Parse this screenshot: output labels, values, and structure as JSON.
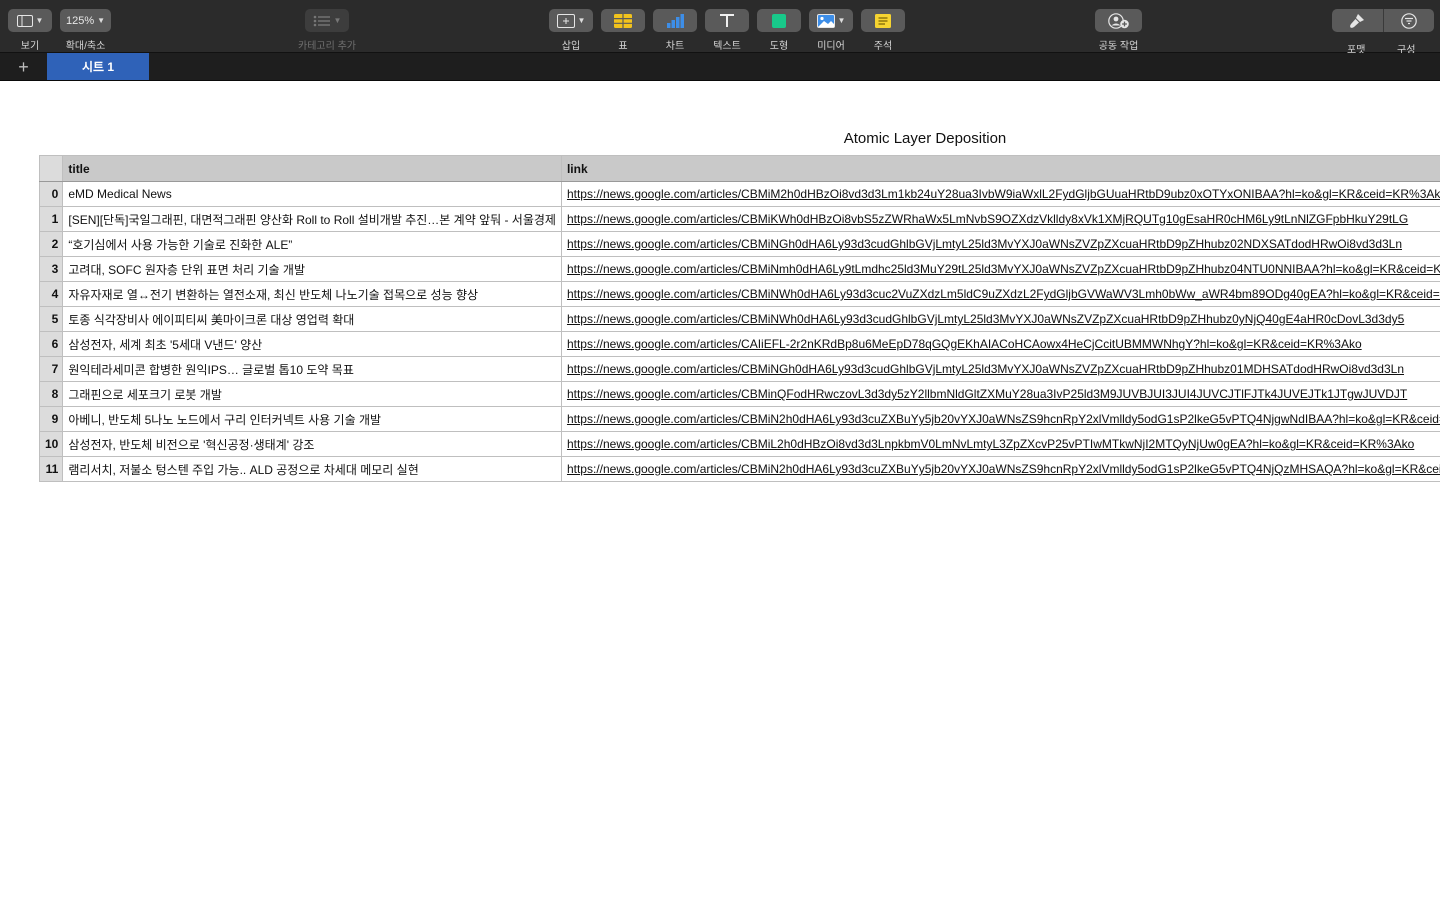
{
  "toolbar": {
    "view_label": "보기",
    "zoom_value": "125%",
    "zoom_label": "확대/축소",
    "category_label": "카테고리 추가",
    "insert_label": "삽입",
    "table_label": "표",
    "chart_label": "차트",
    "text_label": "텍스트",
    "shape_label": "도형",
    "media_label": "미디어",
    "comment_label": "주석",
    "collaborate_label": "공동 작업",
    "format_label": "포맷",
    "organize_label": "구성",
    "colors": {
      "table": "#f2c31d",
      "chart": "#3d8ee8",
      "shape": "#18c98a",
      "comment": "#f6d431"
    }
  },
  "tabs": {
    "add_icon": "plus-icon",
    "sheets": [
      {
        "label": "시트 1",
        "active": true
      }
    ]
  },
  "sheet": {
    "title": "Atomic Layer Deposition",
    "columns": [
      "title",
      "link"
    ],
    "rows": [
      {
        "idx": "0",
        "title": "eMD Medical News",
        "link": "https://news.google.com/articles/CBMiM2h0dHBzOi8vd3d3Lm1kb24uY28ua3IvbW9iaWxlL2FydGljbGUuaHRtbD9ubz0xOTYxONIBAA?hl=ko&gl=KR&ceid=KR%3Ako"
      },
      {
        "idx": "1",
        "title": "[SEN][단독]국일그래핀, 대면적그래핀 양산화 Roll to Roll 설비개발 추진…본 계약 앞둬 - 서울경제",
        "link": "https://news.google.com/articles/CBMiKWh0dHBzOi8vbS5zZWRhaWx5LmNvbS9OZXdzVklldy8xVk1XMjRQUTg10gEsaHR0cHM6Ly9tLnNlZGFpbHkuY29tLG"
      },
      {
        "idx": "2",
        "title": "“호기심에서 사용 가능한 기술로 진화한 ALE”",
        "link": "https://news.google.com/articles/CBMiNGh0dHA6Ly93d3cudGhlbGVjLmtyL25ld3MvYXJ0aWNsZVZpZXcuaHRtbD9pZHhubz02NDXSATdodHRwOi8vd3d3Ln"
      },
      {
        "idx": "3",
        "title": "고려대, SOFC 원자층 단위 표면 처리 기술 개발",
        "link": "https://news.google.com/articles/CBMiNmh0dHA6Ly9tLmdhc25ld3MuY29tL25ld3MvYXJ0aWNsZVZpZXcuaHRtbD9pZHhubz04NTU0NNIBAA?hl=ko&gl=KR&ceid=KR%3Ako"
      },
      {
        "idx": "4",
        "title": "자유자재로 열↔전기 변환하는 열전소재, 최신 반도체 나노기술 접목으로 성능 향상",
        "link": "https://news.google.com/articles/CBMiNWh0dHA6Ly93d3cuc2VuZXdzLm5ldC9uZXdzL2FydGljbGVWaWV3Lmh0bWw_aWR4bm89ODg40gEA?hl=ko&gl=KR&ceid=KR%3Ako"
      },
      {
        "idx": "5",
        "title": "토종 식각장비사 에이피티씨 美마이크론 대상 영업력 확대",
        "link": "https://news.google.com/articles/CBMiNWh0dHA6Ly93d3cudGhlbGVjLmtyL25ld3MvYXJ0aWNsZVZpZXcuaHRtbD9pZHhubz0yNjQ40gE4aHR0cDovL3d3dy5"
      },
      {
        "idx": "6",
        "title": "삼성전자, 세계 최초 '5세대 V낸드' 양산",
        "link": "https://news.google.com/articles/CAIiEFL-2r2nKRdBp8u6MeEpD78qGQgEKhAIACoHCAowx4HeCjCcitUBMMWNhgY?hl=ko&gl=KR&ceid=KR%3Ako"
      },
      {
        "idx": "7",
        "title": "원익테라세미콘 합병한 원익IPS… 글로벌 톱10 도약 목표",
        "link": "https://news.google.com/articles/CBMiNGh0dHA6Ly93d3cudGhlbGVjLmtyL25ld3MvYXJ0aWNsZVZpZXcuaHRtbD9pZHhubz01MDHSATdodHRwOi8vd3d3Ln"
      },
      {
        "idx": "8",
        "title": "그래핀으로 세포크기 로봇 개발",
        "link": "https://news.google.com/articles/CBMinQFodHRwczovL3d3dy5zY2llbmNldGltZXMuY28ua3IvP25ld3M9JUVBJUI3JUI4JUVCJTlFJTk4JUVEJTk1JTgwJUVDJT"
      },
      {
        "idx": "9",
        "title": "아베니, 반도체 5나노 노드에서 구리 인터커넥트 사용 기술 개발",
        "link": "https://news.google.com/articles/CBMiN2h0dHA6Ly93d3cuZXBuYy5jb20vYXJ0aWNsZS9hcnRpY2xlVmlldy5odG1sP2lkeG5vPTQ4NjgwNdIBAA?hl=ko&gl=KR&ceid=KR%3Ako"
      },
      {
        "idx": "10",
        "title": "삼성전자, 반도체 비전으로 '혁신공정·생태계' 강조",
        "link": "https://news.google.com/articles/CBMiL2h0dHBzOi8vd3d3LnpkbmV0LmNvLmtyL3ZpZXcvP25vPTIwMTkwNjI2MTQyNjUw0gEA?hl=ko&gl=KR&ceid=KR%3Ako"
      },
      {
        "idx": "11",
        "title": "램리서치, 저불소 텅스텐 주입 가능.. ALD 공정으로 차세대 메모리 실현",
        "link": "https://news.google.com/articles/CBMiN2h0dHA6Ly93d3cuZXBuYy5jb20vYXJ0aWNsZS9hcnRpY2xlVmlldy5odG1sP2lkeG5vPTQ4NjQzMHSAQA?hl=ko&gl=KR&ceid=KR%3Ako"
      }
    ]
  }
}
